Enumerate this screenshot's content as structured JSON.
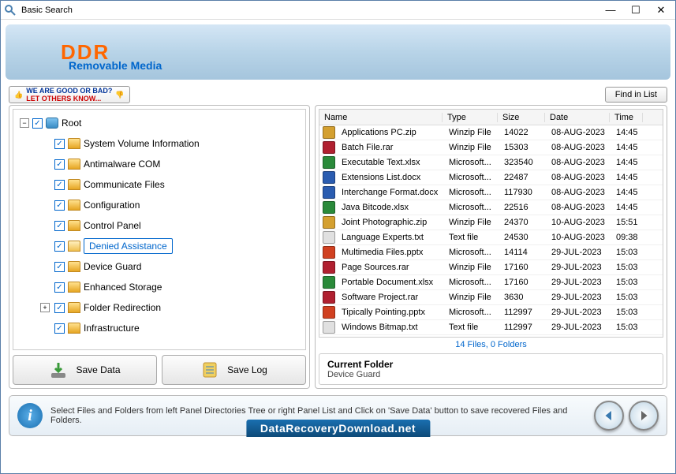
{
  "window": {
    "title": "Basic Search"
  },
  "banner": {
    "title": "DDR",
    "subtitle": "Removable Media"
  },
  "feedback": {
    "line1": "WE ARE GOOD OR BAD?",
    "line2": "LET OTHERS KNOW..."
  },
  "find_button": "Find in List",
  "tree": {
    "root": "Root",
    "items": [
      "System Volume Information",
      "Antimalware COM",
      "Communicate Files",
      "Configuration",
      "Control Panel",
      "Denied Assistance",
      "Device Guard",
      "Enhanced Storage",
      "Folder Redirection",
      "Infrastructure"
    ],
    "selected_index": 5,
    "expandable_index": 8
  },
  "buttons": {
    "save_data": "Save Data",
    "save_log": "Save Log"
  },
  "file_list": {
    "headers": {
      "name": "Name",
      "type": "Type",
      "size": "Size",
      "date": "Date",
      "time": "Time"
    },
    "rows": [
      {
        "name": "Applications PC.zip",
        "type": "Winzip File",
        "size": "14022",
        "date": "08-AUG-2023",
        "time": "14:45",
        "color": "#d4a030"
      },
      {
        "name": "Batch File.rar",
        "type": "Winzip File",
        "size": "15303",
        "date": "08-AUG-2023",
        "time": "14:45",
        "color": "#b02030"
      },
      {
        "name": "Executable Text.xlsx",
        "type": "Microsoft...",
        "size": "323540",
        "date": "08-AUG-2023",
        "time": "14:45",
        "color": "#2a8a3a"
      },
      {
        "name": "Extensions List.docx",
        "type": "Microsoft...",
        "size": "22487",
        "date": "08-AUG-2023",
        "time": "14:45",
        "color": "#2a5cb0"
      },
      {
        "name": "Interchange Format.docx",
        "type": "Microsoft...",
        "size": "117930",
        "date": "08-AUG-2023",
        "time": "14:45",
        "color": "#2a5cb0"
      },
      {
        "name": "Java Bitcode.xlsx",
        "type": "Microsoft...",
        "size": "22516",
        "date": "08-AUG-2023",
        "time": "14:45",
        "color": "#2a8a3a"
      },
      {
        "name": "Joint Photographic.zip",
        "type": "Winzip File",
        "size": "24370",
        "date": "10-AUG-2023",
        "time": "15:51",
        "color": "#d4a030"
      },
      {
        "name": "Language Experts.txt",
        "type": "Text file",
        "size": "24530",
        "date": "10-AUG-2023",
        "time": "09:38",
        "color": "#e0e0e0"
      },
      {
        "name": "Multimedia Files.pptx",
        "type": "Microsoft...",
        "size": "14114",
        "date": "29-JUL-2023",
        "time": "15:03",
        "color": "#d04020"
      },
      {
        "name": "Page Sources.rar",
        "type": "Winzip File",
        "size": "17160",
        "date": "29-JUL-2023",
        "time": "15:03",
        "color": "#b02030"
      },
      {
        "name": "Portable Document.xlsx",
        "type": "Microsoft...",
        "size": "17160",
        "date": "29-JUL-2023",
        "time": "15:03",
        "color": "#2a8a3a"
      },
      {
        "name": "Software Project.rar",
        "type": "Winzip File",
        "size": "3630",
        "date": "29-JUL-2023",
        "time": "15:03",
        "color": "#b02030"
      },
      {
        "name": "Tipically Pointing.pptx",
        "type": "Microsoft...",
        "size": "112997",
        "date": "29-JUL-2023",
        "time": "15:03",
        "color": "#d04020"
      },
      {
        "name": "Windows Bitmap.txt",
        "type": "Text file",
        "size": "112997",
        "date": "29-JUL-2023",
        "time": "15:03",
        "color": "#e0e0e0"
      }
    ]
  },
  "status": "14 Files, 0 Folders",
  "current_folder": {
    "title": "Current Folder",
    "value": "Device Guard"
  },
  "footer": {
    "text": "Select Files and Folders from left Panel Directories Tree or right Panel List and Click on 'Save Data' button to save recovered Files and Folders.",
    "url": "DataRecoveryDownload.net"
  }
}
